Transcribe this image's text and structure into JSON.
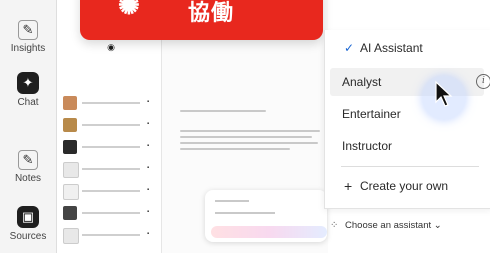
{
  "rail": {
    "items": [
      {
        "label": "Insights",
        "icon": "insights-icon"
      },
      {
        "label": "Chat",
        "icon": "chat-icon"
      },
      {
        "label": "Notes",
        "icon": "notes-icon"
      },
      {
        "label": "Sources",
        "icon": "sources-icon"
      }
    ]
  },
  "toast": {
    "text": "協働",
    "icon": "handshake-icon"
  },
  "menu": {
    "items": [
      {
        "label": "AI Assistant",
        "checked": true
      },
      {
        "label": "Analyst"
      },
      {
        "label": "Entertainer"
      },
      {
        "label": "Instructor"
      }
    ],
    "create_label": "Create your own",
    "create_prefix": "+"
  },
  "footer": {
    "choose_label": "Choose an assistant",
    "chevron": "⌄"
  },
  "colors": {
    "accent": "#1a66d2",
    "toast": "#e8281e",
    "rail": "#f4f4f4"
  }
}
